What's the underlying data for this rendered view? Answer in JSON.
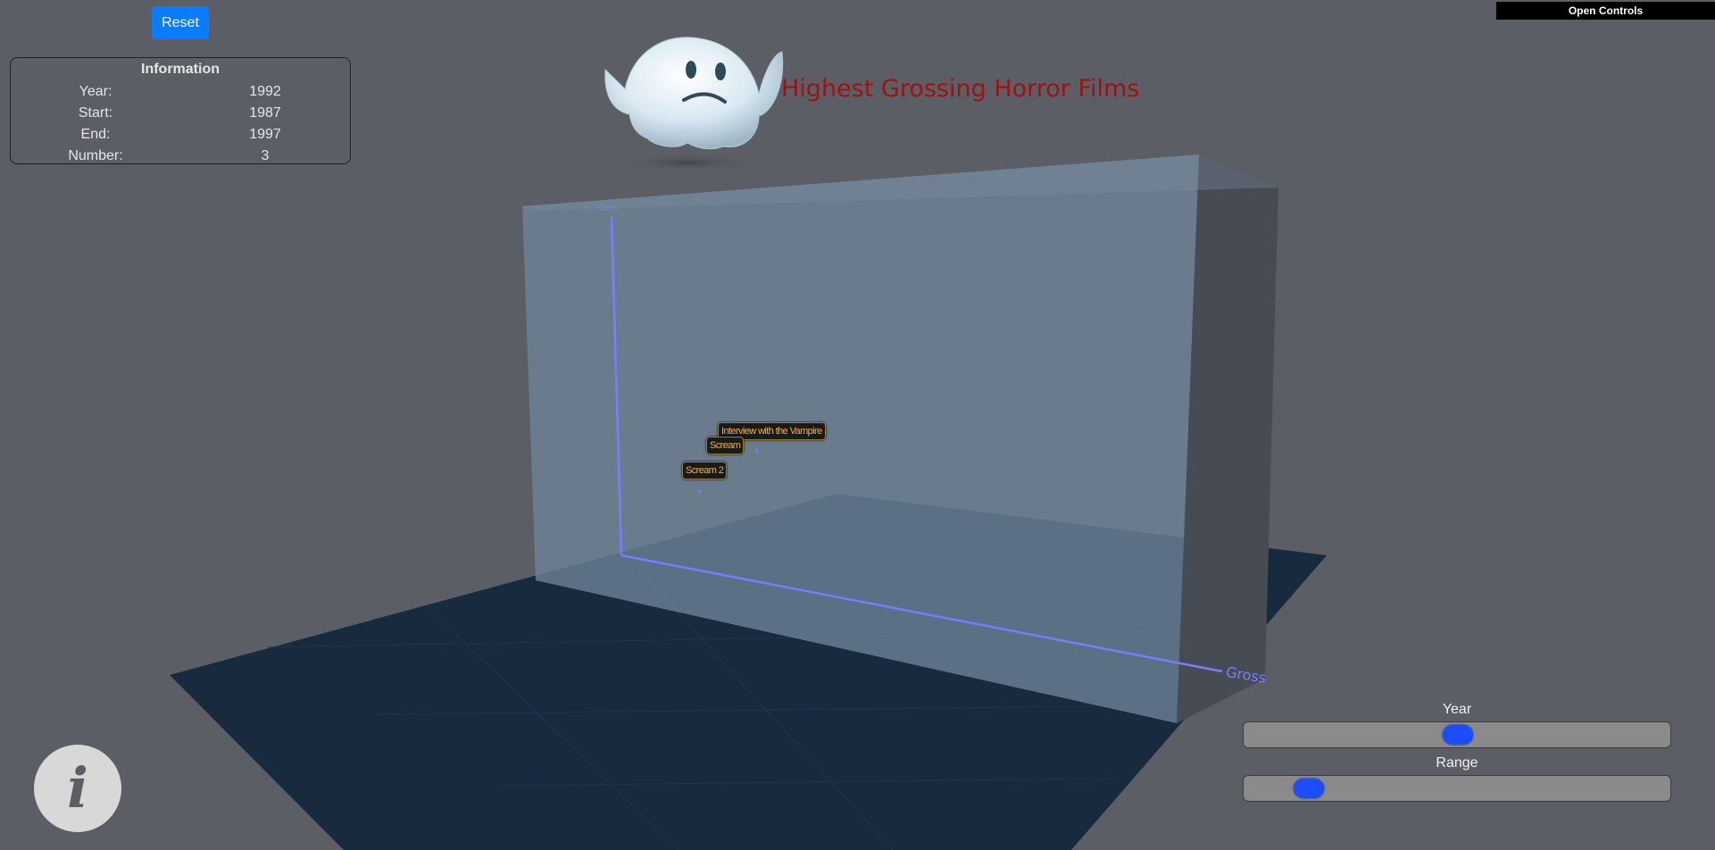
{
  "toolbar": {
    "reset_label": "Reset"
  },
  "info": {
    "title": "Information",
    "rows": [
      {
        "label": "Year:",
        "value": "1992"
      },
      {
        "label": "Start:",
        "value": "1987"
      },
      {
        "label": "End:",
        "value": "1997"
      },
      {
        "label": "Number:",
        "value": "3"
      }
    ]
  },
  "controls": {
    "open_label": "Open Controls"
  },
  "title": "Highest Grossing Horror Films",
  "axes": {
    "x_label": "Gross",
    "y_label": "Gross"
  },
  "films": [
    {
      "name": "Interview with the Vampire"
    },
    {
      "name": "Scream"
    },
    {
      "name": "Scream 2"
    }
  ],
  "sliders": {
    "year": {
      "label": "Year",
      "fraction": 0.5
    },
    "range": {
      "label": "Range",
      "fraction": 0.12
    }
  },
  "colors": {
    "background": "#5b5e64",
    "title": "#a01212",
    "axis": "#7a7cff",
    "label_text": "#f2b23a",
    "accent": "#0a7cff",
    "slider_thumb": "#1c4dff"
  },
  "icons": {
    "info": "info-icon",
    "mascot": "ghost-icon"
  }
}
